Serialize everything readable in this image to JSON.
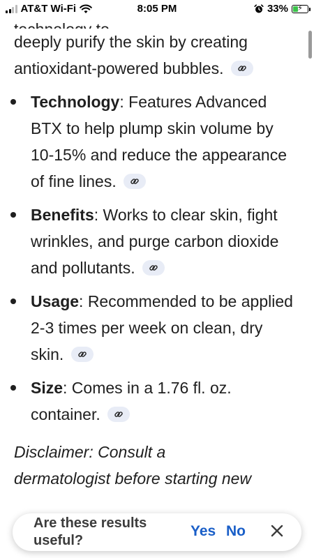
{
  "status_bar": {
    "carrier": "AT&T Wi-Fi",
    "time": "8:05 PM",
    "battery_percent": "33%",
    "battery_level": 0.33,
    "icons": [
      "signal-icon",
      "wifi-icon",
      "alarm-icon",
      "battery-icon"
    ]
  },
  "intro": {
    "cut_line": "Features advanced antioxidant technology to",
    "line_text": "deeply purify the skin by creating antioxidant-powered bubbles."
  },
  "points": [
    {
      "label": "Technology",
      "text": ": Features Advanced BTX to help plump skin volume by 10-15% and reduce the appearance of fine lines."
    },
    {
      "label": "Benefits",
      "text": ": Works to clear skin, fight wrinkles, and purge carbon dioxide and pollutants."
    },
    {
      "label": "Usage",
      "text": ": Recommended to be applied 2-3 times per week on clean, dry skin."
    },
    {
      "label": "Size",
      "text": ": Comes in a 1.76 fl. oz. container."
    }
  ],
  "disclaimer": {
    "line1": "Disclaimer: Consult a",
    "line2": "dermatologist before starting new"
  },
  "feedback": {
    "question": "Are these results useful?",
    "yes_label": "Yes",
    "no_label": "No"
  },
  "colors": {
    "accent": "#1a5fc8",
    "chip_bg": "#e8ecf6",
    "text": "#1f1f1f"
  }
}
